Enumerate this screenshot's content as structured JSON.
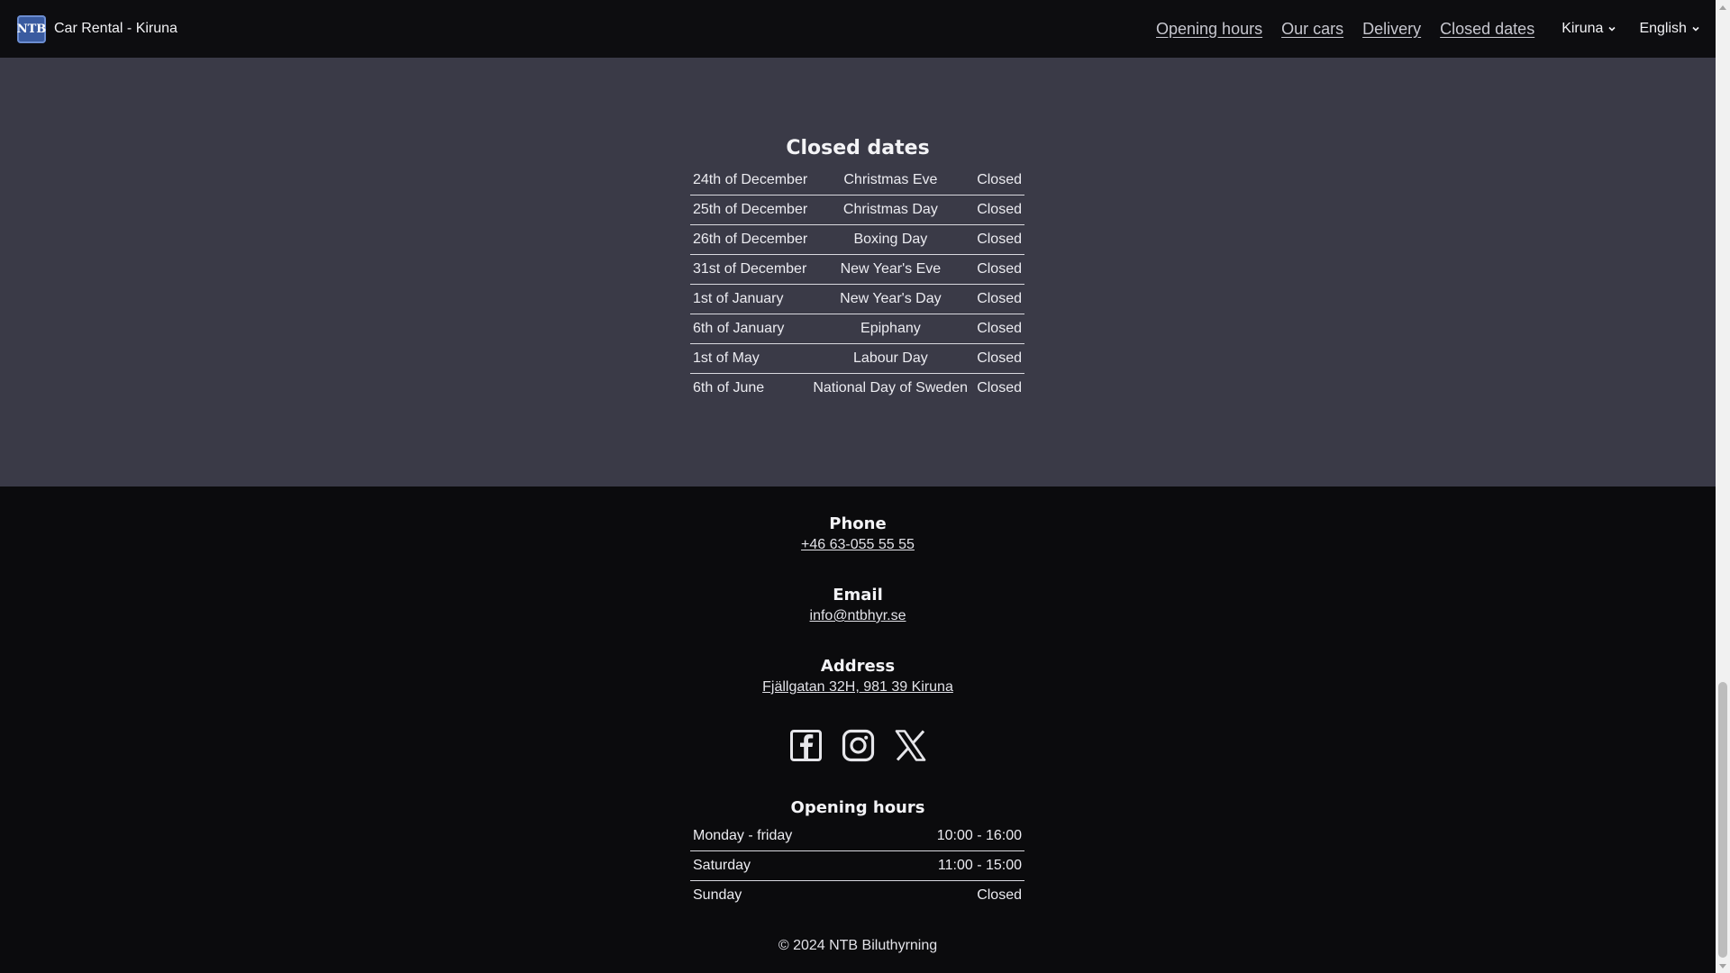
{
  "header": {
    "logo_text": "NTB",
    "title": "Car Rental - Kiruna",
    "nav": [
      "Opening hours",
      "Our cars",
      "Delivery",
      "Closed dates"
    ],
    "city_select": "Kiruna",
    "language_select": "English"
  },
  "closed_dates": {
    "title": "Closed dates",
    "rows": [
      {
        "date": "24th of December",
        "holiday": "Christmas Eve",
        "status": "Closed"
      },
      {
        "date": "25th of December",
        "holiday": "Christmas Day",
        "status": "Closed"
      },
      {
        "date": "26th of December",
        "holiday": "Boxing Day",
        "status": "Closed"
      },
      {
        "date": "31st of December",
        "holiday": "New Year's Eve",
        "status": "Closed"
      },
      {
        "date": "1st of January",
        "holiday": "New Year's Day",
        "status": "Closed"
      },
      {
        "date": "6th of January",
        "holiday": "Epiphany",
        "status": "Closed"
      },
      {
        "date": "1st of May",
        "holiday": "Labour Day",
        "status": "Closed"
      },
      {
        "date": "6th of June",
        "holiday": "National Day of Sweden",
        "status": "Closed"
      }
    ]
  },
  "footer": {
    "phone_title": "Phone",
    "phone": "+46 63-055 55 55",
    "email_title": "Email",
    "email": "info@ntbhyr.se",
    "address_title": "Address",
    "address": "Fjällgatan 32H, 981 39 Kiruna",
    "socials": [
      "facebook-icon",
      "instagram-icon",
      "x-icon"
    ],
    "hours_title": "Opening hours",
    "hours": [
      {
        "day": "Monday - friday",
        "time": "10:00 - 16:00"
      },
      {
        "day": "Saturday",
        "time": "11:00 - 15:00"
      },
      {
        "day": "Sunday",
        "time": "Closed"
      }
    ],
    "copyright": "© 2024 NTB Biluthyrning"
  },
  "colors": {
    "header_bg": "#0d0d10",
    "section_bg": "#3a3a47",
    "footer_bg": "#0b0b0d",
    "logo_bg": "#3a5ba0"
  }
}
